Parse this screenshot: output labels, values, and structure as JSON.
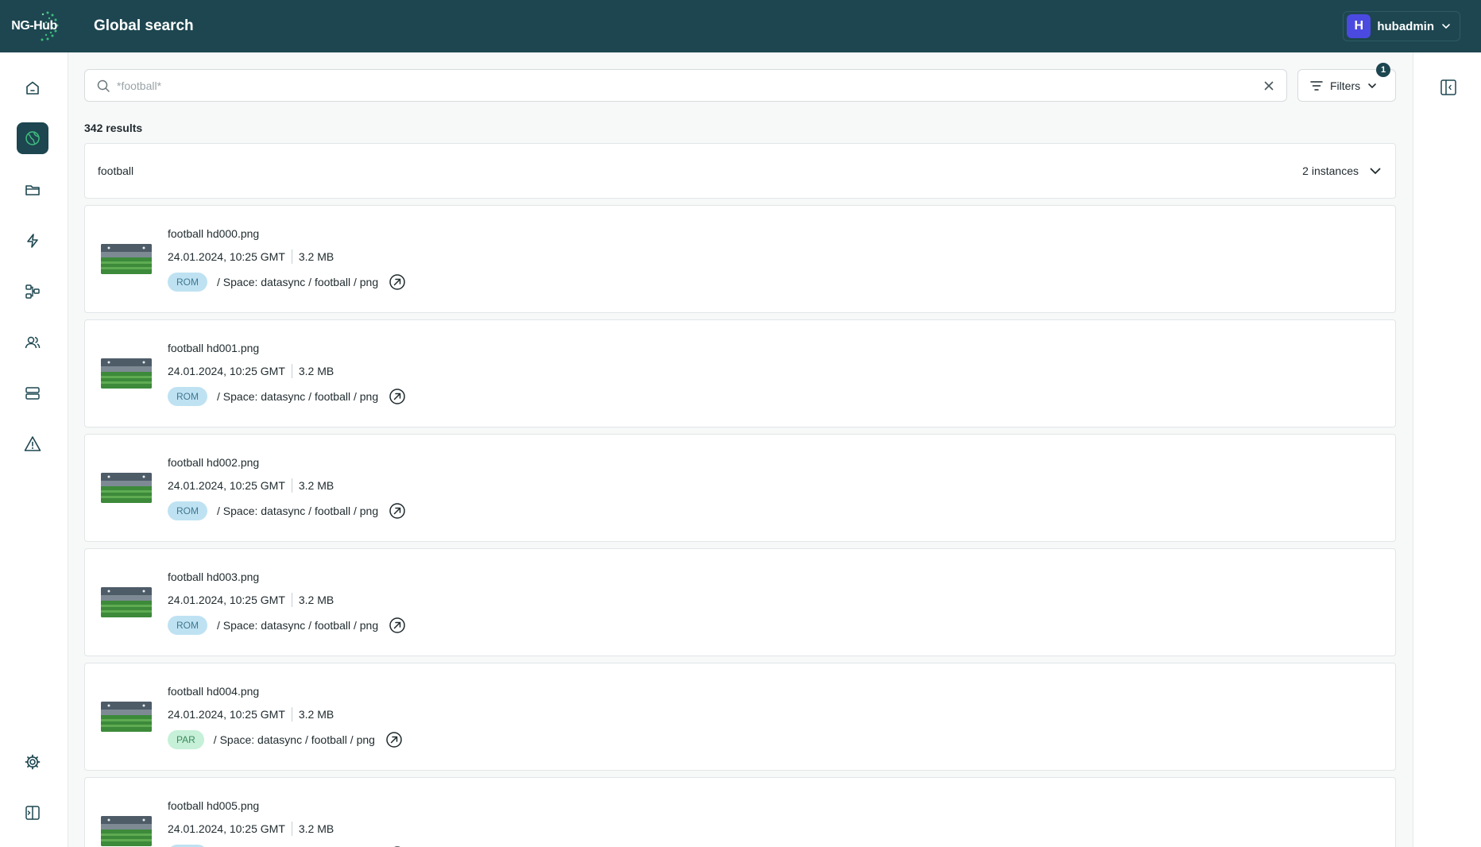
{
  "app": {
    "logo_text": "NG-Hub",
    "page_title": "Global search"
  },
  "user": {
    "initial": "H",
    "name": "hubadmin"
  },
  "nav": [
    {
      "name": "home-icon"
    },
    {
      "name": "globe-icon",
      "active": true
    },
    {
      "name": "folder-icon"
    },
    {
      "name": "lightning-icon"
    },
    {
      "name": "workflow-icon"
    },
    {
      "name": "users-icon"
    },
    {
      "name": "storage-icon"
    },
    {
      "name": "warning-icon"
    },
    {
      "name": "gear-icon"
    },
    {
      "name": "collapse-sidebar-icon"
    }
  ],
  "search": {
    "placeholder": "*football*",
    "value": ""
  },
  "filters": {
    "label": "Filters",
    "count": "1"
  },
  "results": {
    "count_label": "342 results"
  },
  "group": {
    "name": "football",
    "instances_label": "2 instances"
  },
  "items": [
    {
      "name": "football hd000.png",
      "date": "24.01.2024, 10:25 GMT",
      "size": "3.2 MB",
      "tag": "ROM",
      "path": "/ Space: datasync / football / png"
    },
    {
      "name": "football hd001.png",
      "date": "24.01.2024, 10:25 GMT",
      "size": "3.2 MB",
      "tag": "ROM",
      "path": "/ Space: datasync / football / png"
    },
    {
      "name": "football hd002.png",
      "date": "24.01.2024, 10:25 GMT",
      "size": "3.2 MB",
      "tag": "ROM",
      "path": "/ Space: datasync / football / png"
    },
    {
      "name": "football hd003.png",
      "date": "24.01.2024, 10:25 GMT",
      "size": "3.2 MB",
      "tag": "ROM",
      "path": "/ Space: datasync / football / png"
    },
    {
      "name": "football hd004.png",
      "date": "24.01.2024, 10:25 GMT",
      "size": "3.2 MB",
      "tag": "PAR",
      "path": "/ Space: datasync / football / png"
    },
    {
      "name": "football hd005.png",
      "date": "24.01.2024, 10:25 GMT",
      "size": "3.2 MB",
      "tag": "ROM",
      "path": "/ Space: datasync / football / png"
    }
  ],
  "colors": {
    "header_bg": "#1d4650",
    "rom_tag": "#bfe2f2",
    "par_tag": "#c6f0d8",
    "avatar": "#4b4ae0"
  }
}
